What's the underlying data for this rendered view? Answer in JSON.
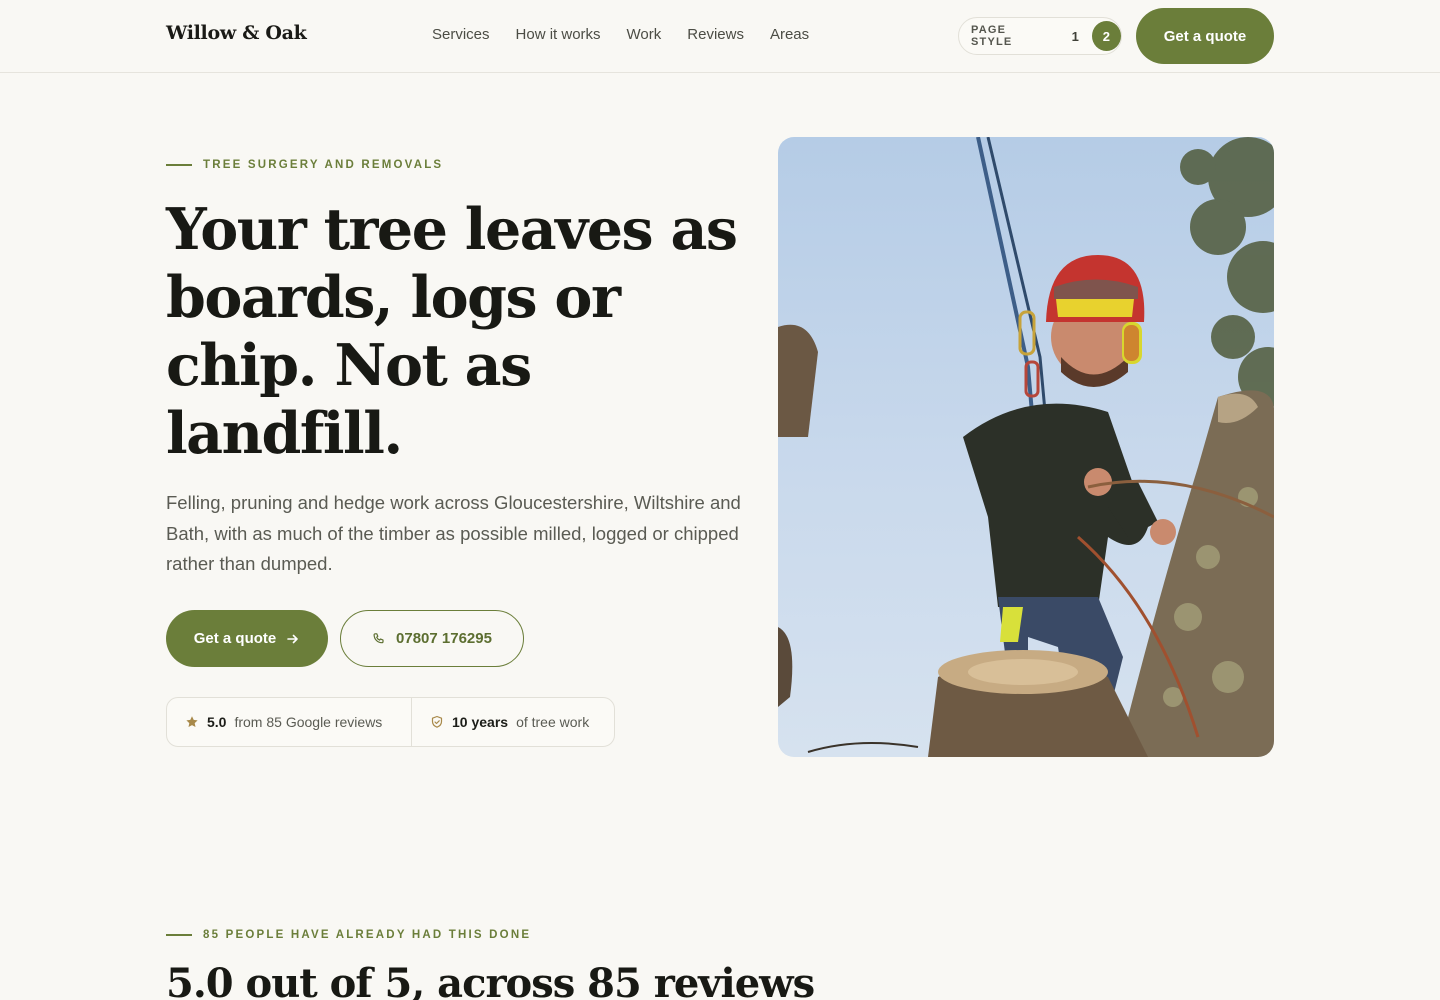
{
  "header": {
    "logo": "Willow & Oak",
    "nav": [
      "Services",
      "How it works",
      "Work",
      "Reviews",
      "Areas"
    ],
    "page_style_label": "PAGE STYLE",
    "page_style_options": [
      "1",
      "2"
    ],
    "page_style_selected": "2",
    "cta_label": "Get a quote"
  },
  "hero": {
    "eyebrow": "TREE SURGERY AND REMOVALS",
    "title": "Your tree leaves as boards, logs or chip. Not as landfill.",
    "subtitle": "Felling, pruning and hedge work across Gloucestershire, Wiltshire and Bath, with as much of the timber as possible milled, logged or chipped rather than dumped.",
    "primary_button": "Get a quote",
    "phone_button": "07807 176295",
    "stats": {
      "rating_value": "5.0",
      "rating_text": "from 85 Google reviews",
      "years_value": "10 years",
      "years_text": "of tree work"
    }
  },
  "reviews_section": {
    "eyebrow": "85 PEOPLE HAVE ALREADY HAD THIS DONE",
    "title": "5.0 out of 5, across 85 reviews"
  },
  "icons": {
    "arrow": "arrow-right-icon",
    "phone": "phone-icon",
    "star": "star-icon",
    "shield": "shield-check-icon"
  },
  "colors": {
    "accent": "#6b7e3a",
    "background": "#f9f8f4",
    "text": "#181914",
    "star": "#a8894a"
  }
}
